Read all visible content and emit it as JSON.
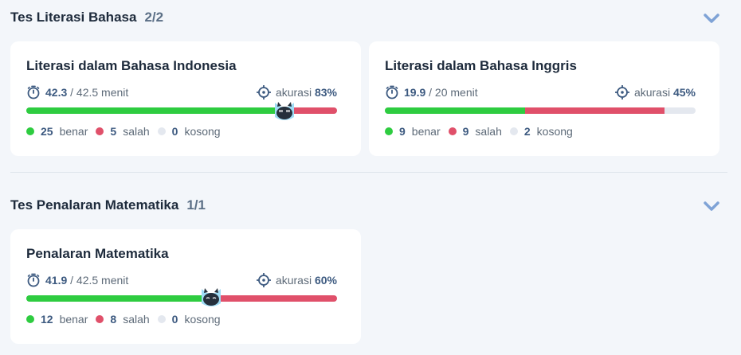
{
  "sections": [
    {
      "title": "Tes Literasi Bahasa",
      "count": "2/2",
      "cards": [
        {
          "title": "Literasi dalam Bahasa Indonesia",
          "time_used": "42.3",
          "time_total": "/ 42.5 menit",
          "accuracy_label": "akurasi",
          "accuracy_value": "83%",
          "benar": "25",
          "salah": "5",
          "kosong": "0",
          "bar": {
            "benar_fraction": 0.833,
            "salah_fraction": 0.167
          }
        },
        {
          "title": "Literasi dalam Bahasa Inggris",
          "time_used": "19.9",
          "time_total": "/ 20 menit",
          "accuracy_label": "akurasi",
          "accuracy_value": "45%",
          "benar": "9",
          "salah": "9",
          "kosong": "2",
          "bar": {
            "benar_fraction": 0.45,
            "salah_fraction": 0.45
          }
        }
      ]
    },
    {
      "title": "Tes Penalaran Matematika",
      "count": "1/1",
      "cards": [
        {
          "title": "Penalaran Matematika",
          "time_used": "41.9",
          "time_total": "/ 42.5 menit",
          "accuracy_label": "akurasi",
          "accuracy_value": "60%",
          "benar": "12",
          "salah": "8",
          "kosong": "0",
          "bar": {
            "benar_fraction": 0.6,
            "salah_fraction": 0.4
          }
        }
      ]
    }
  ],
  "legend": {
    "benar": "benar",
    "salah": "salah",
    "kosong": "kosong"
  },
  "colors": {
    "accent": "#3d5a80",
    "benar": "#2ecc40",
    "salah": "#e0506a",
    "kosong": "#e4e8ef",
    "chevron": "#7fa3d6"
  },
  "icons": {
    "timer": "stopwatch-icon",
    "accuracy": "crosshair-icon",
    "collapse": "chevron-down-icon",
    "mascot": "cat-mascot-icon"
  }
}
